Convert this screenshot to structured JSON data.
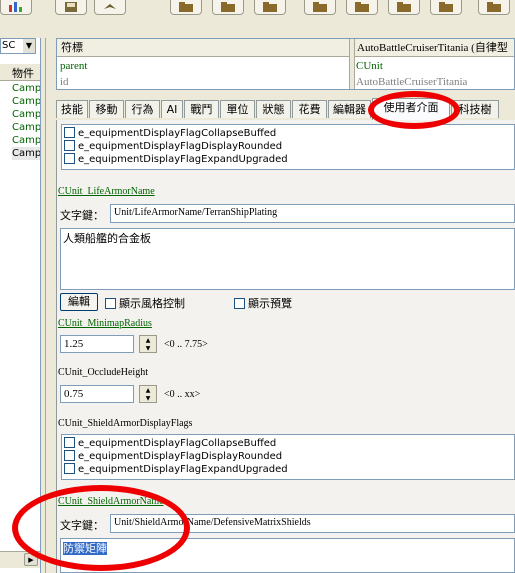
{
  "toolbar": {
    "icons": [
      "chart-icon",
      "save-icon",
      "folder-icon",
      "folder-icon",
      "folder-icon",
      "folder-icon",
      "folder-icon",
      "folder-icon",
      "folder-icon"
    ]
  },
  "left_panel": {
    "combo_value": "SC",
    "header": "物件",
    "items": [
      "Camp",
      "Camp",
      "Camp",
      "Camp",
      "Camp",
      "Camp"
    ]
  },
  "info": {
    "col1_header": "符標",
    "col2_header": "AutoBattleCruiserTitania (自律型",
    "row1_key": "parent",
    "row1_value": "CUnit",
    "row2_key": "id",
    "row2_value": "AutoBattleCruiserTitania"
  },
  "tabs": [
    "技能",
    "移動",
    "行為",
    "AI",
    "戰鬥",
    "單位",
    "狀態",
    "花費",
    "編輯器",
    "使用者介面",
    "科技樹"
  ],
  "active_tab": "使用者介面",
  "flags_top": [
    "e_equipmentDisplayFlagCollapseBuffed",
    "e_equipmentDisplayFlagDisplayRounded",
    "e_equipmentDisplayFlagExpandUpgraded"
  ],
  "life_armor": {
    "label": "CUnit_LifeArmorName",
    "key_label": "文字鍵：",
    "key_value": "Unit/LifeArmorName/TerranShipPlating",
    "text": "人類船艦的合金板",
    "edit_button": "編輯",
    "style_check": "顯示風格控制",
    "preview_check": "顯示預覽"
  },
  "minimap": {
    "label": "CUnit_MinimapRadius",
    "value": "1.25",
    "range": "<0 .. 7.75>"
  },
  "occlude": {
    "label": "CUnit_OccludeHeight",
    "value": "0.75",
    "range": "<0 .. xx>"
  },
  "shield_flags": {
    "label": "CUnit_ShieldArmorDisplayFlags",
    "items": [
      "e_equipmentDisplayFlagCollapseBuffed",
      "e_equipmentDisplayFlagDisplayRounded",
      "e_equipmentDisplayFlagExpandUpgraded"
    ]
  },
  "shield_name": {
    "label": "CUnit_ShieldArmorName",
    "key_label": "文字鍵：",
    "key_value": "Unit/ShieldArmorName/DefensiveMatrixShields",
    "text": "防禦矩陣"
  },
  "colors": {
    "annotation_red": "#ee0000",
    "link_green": "#006400",
    "selection_blue": "#316ac5"
  }
}
